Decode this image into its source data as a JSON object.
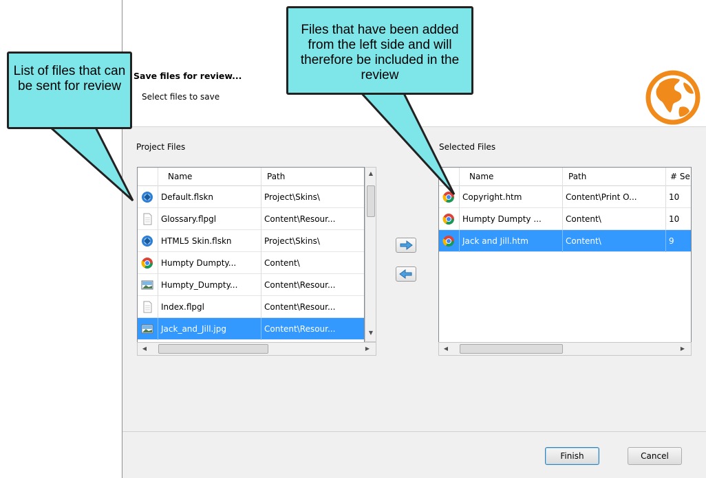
{
  "dialog": {
    "title": "Save files for review...",
    "subtitle": "Select files to save"
  },
  "project_files": {
    "label": "Project Files",
    "columns": [
      "Name",
      "Path"
    ],
    "rows": [
      {
        "name": "Default.flskn",
        "path": "Project\\Skins\\",
        "icon": "skin-icon",
        "selected": false
      },
      {
        "name": "Glossary.flpgl",
        "path": "Content\\Resour...",
        "icon": "page-layout-icon",
        "selected": false
      },
      {
        "name": "HTML5 Skin.flskn",
        "path": "Project\\Skins\\",
        "icon": "skin-icon",
        "selected": false
      },
      {
        "name": "Humpty Dumpty...",
        "path": "Content\\",
        "icon": "chrome-icon",
        "selected": false
      },
      {
        "name": "Humpty_Dumpty...",
        "path": "Content\\Resour...",
        "icon": "image-icon",
        "selected": false
      },
      {
        "name": "Index.flpgl",
        "path": "Content\\Resour...",
        "icon": "page-layout-icon",
        "selected": false
      },
      {
        "name": "Jack_and_Jill.jpg",
        "path": "Content\\Resour...",
        "icon": "image-icon",
        "selected": true
      }
    ]
  },
  "selected_files": {
    "label": "Selected Files",
    "columns": [
      "Name",
      "Path",
      "# Se"
    ],
    "rows": [
      {
        "name": "Copyright.htm",
        "path": "Content\\Print O...",
        "count": "10",
        "icon": "chrome-icon",
        "selected": false
      },
      {
        "name": "Humpty Dumpty ...",
        "path": "Content\\",
        "count": "10",
        "icon": "chrome-icon",
        "selected": false
      },
      {
        "name": "Jack and Jill.htm",
        "path": "Content\\",
        "count": "9",
        "icon": "chrome-icon",
        "selected": true
      }
    ]
  },
  "buttons": {
    "add": "right-arrow-icon",
    "remove": "left-arrow-icon",
    "finish": "Finish",
    "cancel": "Cancel"
  },
  "callouts": {
    "left": "List of files that can be sent for review",
    "right": "Files that have been added from the left side and will therefore be included in the review"
  },
  "colors": {
    "selection": "#3399ff",
    "callout": "#7ee6e9",
    "globe": "#f08a1a"
  }
}
